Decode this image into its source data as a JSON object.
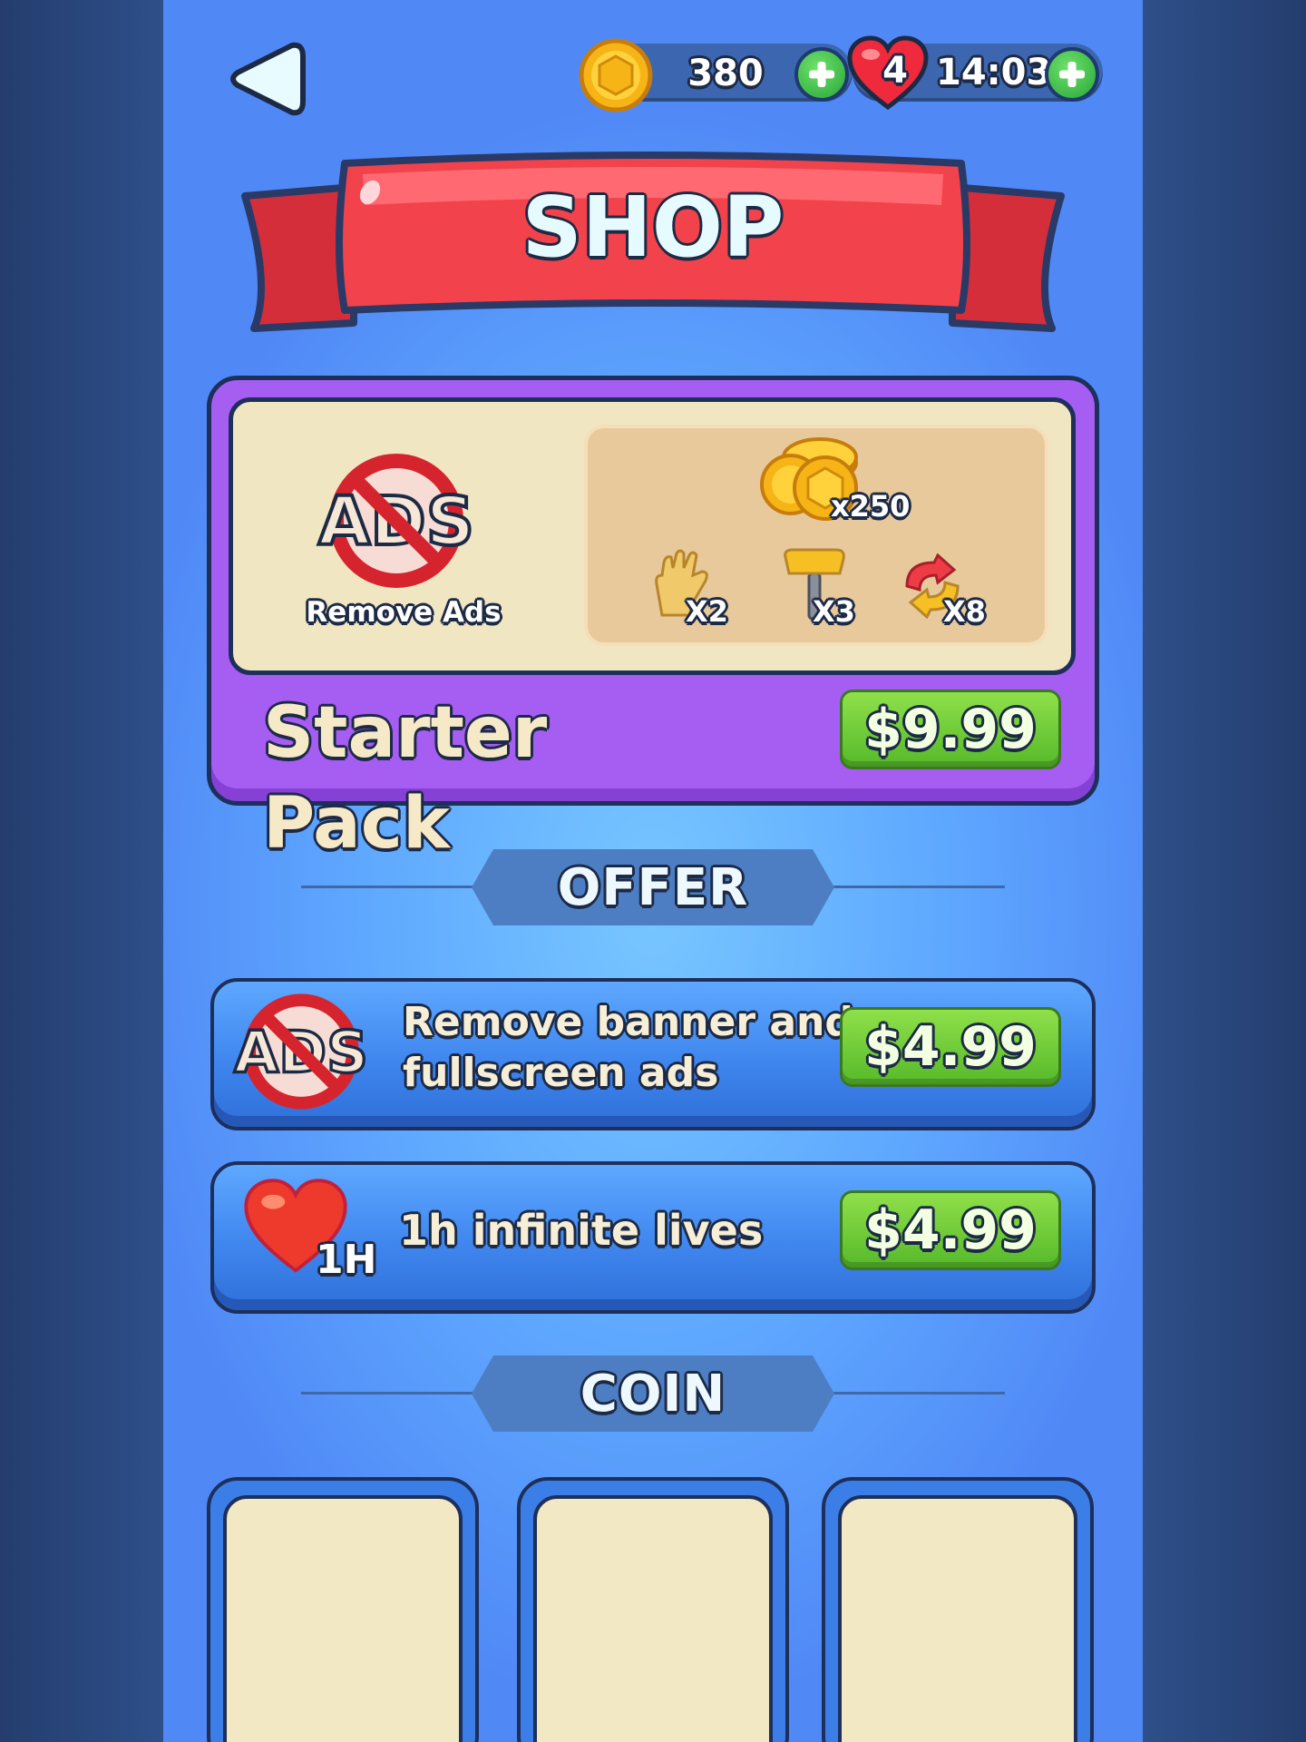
{
  "header": {
    "coins": "380",
    "lives": "4",
    "timer": "14:03"
  },
  "banner": {
    "title": "SHOP"
  },
  "starter_pack": {
    "remove_ads_icon_text": "ADS",
    "remove_ads_label": "Remove Ads",
    "coins_amount": "x250",
    "items": [
      {
        "icon": "glove-icon",
        "qty": "X2"
      },
      {
        "icon": "hammer-icon",
        "qty": "X3"
      },
      {
        "icon": "shuffle-icon",
        "qty": "X8"
      }
    ],
    "title": "Starter Pack",
    "price": "$9.99"
  },
  "sections": {
    "offer": "OFFER",
    "coin": "COIN"
  },
  "offers": [
    {
      "icon": "no-ads-icon",
      "icon_text": "ADS",
      "label_line1": "Remove banner and",
      "label_line2": "fullscreen ads",
      "price": "$4.99"
    },
    {
      "icon": "heart-icon",
      "icon_text": "1H",
      "label_line1": "1h infinite lives",
      "price": "$4.99"
    }
  ],
  "colors": {
    "accent_purple": "#a55df2",
    "banner_red": "#f2424c",
    "price_green": "#6ccc35"
  }
}
